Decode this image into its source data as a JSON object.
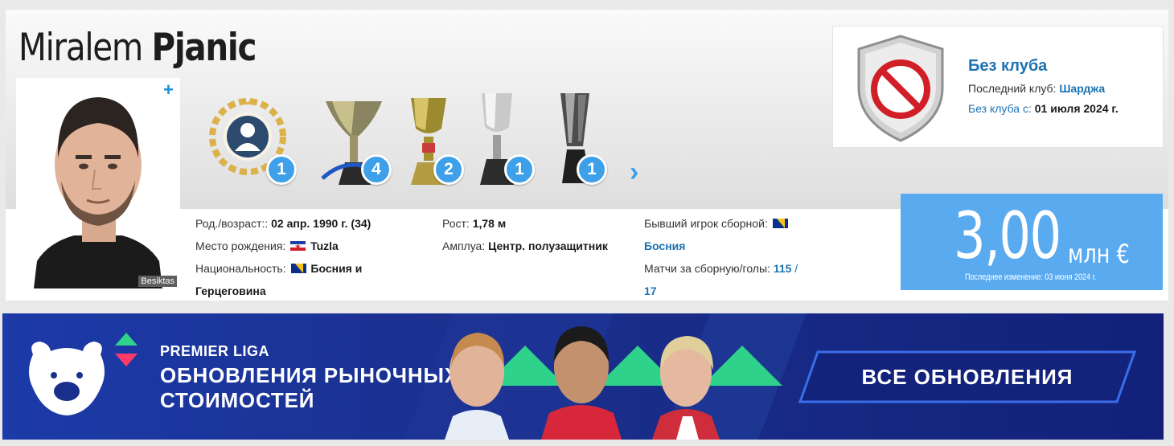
{
  "player": {
    "first_name": "Miralem",
    "last_name": "Pjanic",
    "photo_club_tag": "Besiktas",
    "add_symbol": "+"
  },
  "trophies": [
    {
      "icon": "player-of-year-laurel-icon",
      "count": "1"
    },
    {
      "icon": "serie-a-trophy-icon",
      "count": "4"
    },
    {
      "icon": "coppa-italia-trophy-icon",
      "count": "2"
    },
    {
      "icon": "copa-del-rey-trophy-icon",
      "count": "1"
    },
    {
      "icon": "supercoppa-trophy-icon",
      "count": "1"
    }
  ],
  "trophies_next_icon": "chevron-right-icon",
  "club": {
    "icon": "no-club-prohibited-icon",
    "name": "Без клуба",
    "last_club_label": "Последний клуб:",
    "last_club": "Шарджа",
    "since_label_link": "Без клуба",
    "since_label_rest": "с:",
    "since_date": "01 июля 2024 г."
  },
  "info": {
    "birth_label": "Род./возраст::",
    "birth_value": "02 апр. 1990 г. (34)",
    "birthplace_label": "Место рождения:",
    "birthplace_value": "Tuzla",
    "nationality_label": "Национальность:",
    "nationality_value_1": "Босния и",
    "nationality_value_2": "Герцеговина",
    "height_label": "Рост:",
    "height_value": "1,78 м",
    "position_label": "Амплуа:",
    "position_value": "Центр. полузащитник",
    "former_intl_label": "Бывший игрок сборной:",
    "former_intl_value": "Босния",
    "caps_label": "Матчи за сборную/голы:",
    "caps_value": "115",
    "caps_sep": "/",
    "goals_value": "17"
  },
  "market_value": {
    "amount": "3,00",
    "unit": "млн €",
    "last_change": "Последнее изменение: 03 июня 2024 г."
  },
  "banner": {
    "logo_icon": "bear-logo-icon",
    "league": "PREMIER LIGA",
    "title_line_1": "ОБНОВЛЕНИЯ РЫНОЧНЫХ",
    "title_line_2": "СТОИМОСТЕЙ",
    "cta": "ВСЕ ОБНОВЛЕНИЯ"
  },
  "colors": {
    "link": "#1c73b2",
    "badge": "#3da0e8",
    "value_box": "#5aaaf0",
    "banner": "#1a2f8c",
    "accent_green": "#2fd28a",
    "accent_red": "#ff3a6a"
  }
}
